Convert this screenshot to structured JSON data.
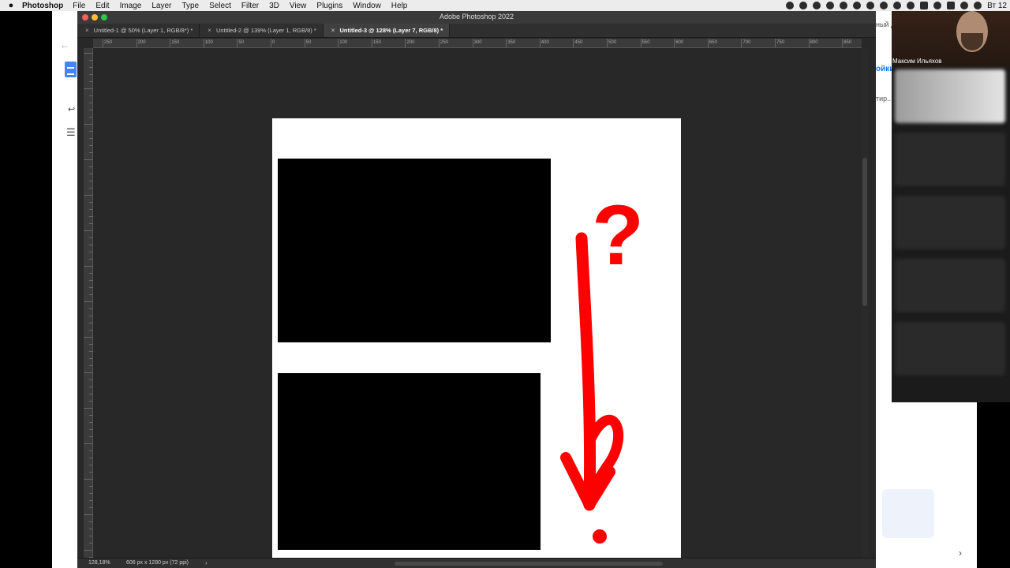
{
  "menubar": {
    "app_name": "Photoshop",
    "items": [
      "File",
      "Edit",
      "Image",
      "Layer",
      "Type",
      "Select",
      "Filter",
      "3D",
      "View",
      "Plugins",
      "Window",
      "Help"
    ],
    "clock": "Вт 12"
  },
  "window": {
    "title": "Adobe Photoshop 2022",
    "traffic_colors": [
      "#fc5f57",
      "#fdbc2e",
      "#28c840"
    ]
  },
  "tabs": [
    {
      "label": "Untitled-1 @ 50% (Layer 1, RGB/8*) *",
      "active": false
    },
    {
      "label": "Untitled-2 @ 139% (Layer 1, RGB/8) *",
      "active": false
    },
    {
      "label": "Untitled-3 @ 128% (Layer 7, RGB/8) *",
      "active": true
    }
  ],
  "ruler_top_labels": [
    "250",
    "200",
    "150",
    "100",
    "50",
    "0",
    "50",
    "100",
    "150",
    "200",
    "250",
    "300",
    "350",
    "400",
    "450",
    "500",
    "550",
    "600",
    "650",
    "700",
    "750",
    "800",
    "850"
  ],
  "annotation": {
    "mark": "?",
    "color": "#ff0000"
  },
  "status": {
    "zoom": "128,18%",
    "doc_size": "606 px x 1280 px (72 ppi)",
    "arrow": "›"
  },
  "background_right": {
    "snippet1": "ный до",
    "snippet2": "ойки",
    "snippet3": "тир...",
    "chevron": "›"
  },
  "call": {
    "participant": "Максим Ильяхов"
  }
}
